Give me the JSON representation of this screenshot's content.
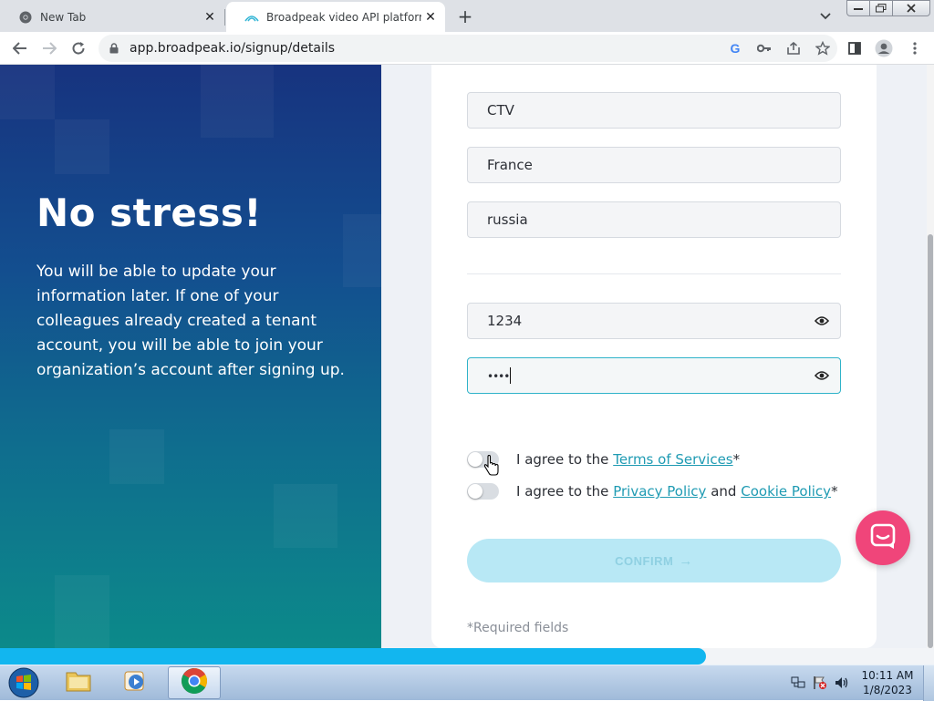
{
  "browser": {
    "tabs": [
      {
        "title": "New Tab",
        "active": false
      },
      {
        "title": "Broadpeak video API platform",
        "active": true
      }
    ],
    "new_tab_symbol": "+",
    "address": "app.broadpeak.io/signup/details"
  },
  "left_panel": {
    "heading": "No stress!",
    "body": "You will be able to update your information later. If one of your colleagues already created a tenant account, you will be able to join your organization’s account after signing up."
  },
  "form": {
    "fields": [
      {
        "value": "CTV"
      },
      {
        "value": "France"
      },
      {
        "value": "russia"
      },
      {
        "value": "1234",
        "type": "password-revealed"
      },
      {
        "value": "••••",
        "type": "password-masked"
      }
    ],
    "terms": {
      "prefix": "I agree to the",
      "link": "Terms of Services",
      "suffix": "*",
      "checked": false
    },
    "privacy": {
      "prefix": "I agree to the",
      "link1": "Privacy Policy",
      "joiner": "and",
      "link2": "Cookie Policy",
      "suffix": "*",
      "checked": false
    },
    "confirm_label": "CONFIRM",
    "required_note": "*Required fields"
  },
  "progress": {
    "fraction": 0.756
  },
  "taskbar": {
    "time": "10:11 AM",
    "date": "1/8/2023"
  },
  "colors": {
    "accent": "#1f9bb3",
    "confirm_disabled": "#b8e8f5",
    "chat": "#f0457a",
    "progress": "#12b6ef"
  },
  "icons": {
    "chrome_tab": "chrome-icon",
    "site_tab": "broadpeak-logo-icon",
    "eye": "eye-icon",
    "chat": "chat-icon"
  }
}
